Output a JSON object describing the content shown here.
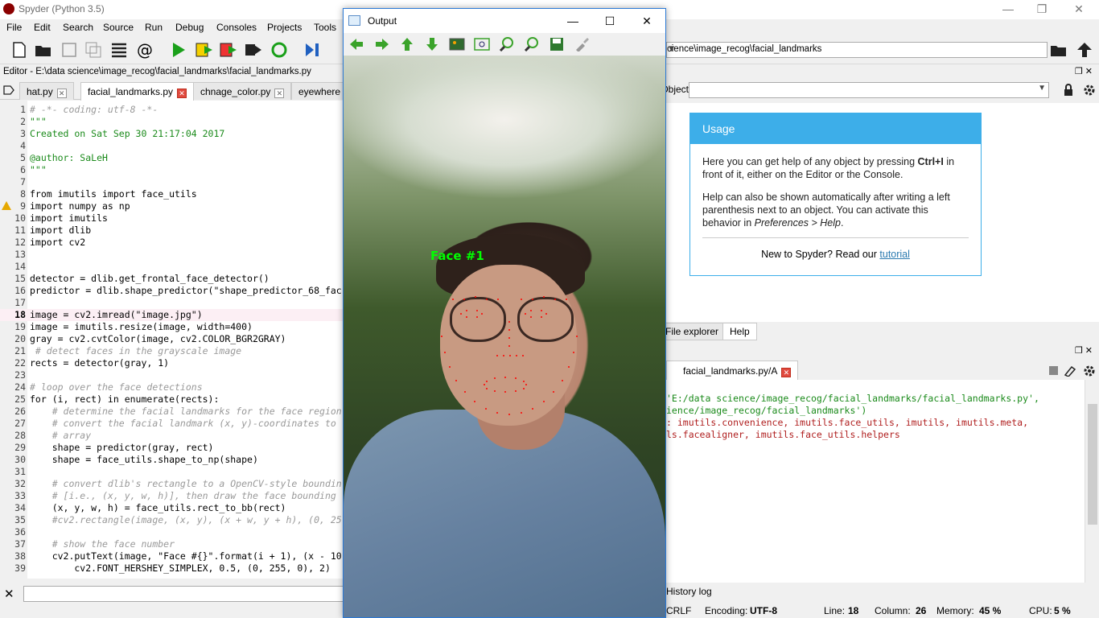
{
  "window": {
    "title": "Spyder (Python 3.5)",
    "controls": {
      "minimize": "—",
      "restore": "❐",
      "close": "✕"
    }
  },
  "menu": [
    "File",
    "Edit",
    "Search",
    "Source",
    "Run",
    "Debug",
    "Consoles",
    "Projects",
    "Tools"
  ],
  "editor": {
    "path": "Editor - E:\\data science\\image_recog\\facial_landmarks\\facial_landmarks.py",
    "tabs": [
      "hat.py",
      "facial_landmarks.py",
      "chnage_color.py",
      "eyewhere"
    ],
    "active_tab": "facial_landmarks.py",
    "lines": [
      {
        "n": "1",
        "t": "# -*- coding: utf-8 -*-",
        "c": "cmt"
      },
      {
        "n": "2",
        "t": "\"\"\"",
        "c": "str"
      },
      {
        "n": "3",
        "t": "Created on Sat Sep 30 21:17:04 2017",
        "c": "str"
      },
      {
        "n": "4",
        "t": "",
        "c": ""
      },
      {
        "n": "5",
        "t": "@author: SaLeH",
        "c": "str"
      },
      {
        "n": "6",
        "t": "\"\"\"",
        "c": "str"
      },
      {
        "n": "7",
        "t": "",
        "c": ""
      },
      {
        "n": "8",
        "t": "from imutils import face_utils",
        "c": ""
      },
      {
        "n": "9",
        "t": "import numpy as np",
        "c": ""
      },
      {
        "n": "10",
        "t": "import imutils",
        "c": ""
      },
      {
        "n": "11",
        "t": "import dlib",
        "c": ""
      },
      {
        "n": "12",
        "t": "import cv2",
        "c": ""
      },
      {
        "n": "13",
        "t": "",
        "c": ""
      },
      {
        "n": "14",
        "t": "",
        "c": ""
      },
      {
        "n": "15",
        "t": "detector = dlib.get_frontal_face_detector()",
        "c": ""
      },
      {
        "n": "16",
        "t": "predictor = dlib.shape_predictor(\"shape_predictor_68_fac",
        "c": ""
      },
      {
        "n": "17",
        "t": "",
        "c": ""
      },
      {
        "n": "18",
        "t": "image = cv2.imread(\"image.jpg\")",
        "c": ""
      },
      {
        "n": "19",
        "t": "image = imutils.resize(image, width=400)",
        "c": ""
      },
      {
        "n": "20",
        "t": "gray = cv2.cvtColor(image, cv2.COLOR_BGR2GRAY)",
        "c": ""
      },
      {
        "n": "21",
        "t": " # detect faces in the grayscale image",
        "c": "cmt"
      },
      {
        "n": "22",
        "t": "rects = detector(gray, 1)",
        "c": ""
      },
      {
        "n": "23",
        "t": "",
        "c": ""
      },
      {
        "n": "24",
        "t": "# loop over the face detections",
        "c": "cmt"
      },
      {
        "n": "25",
        "t": "for (i, rect) in enumerate(rects):",
        "c": ""
      },
      {
        "n": "26",
        "t": "    # determine the facial landmarks for the face region",
        "c": "cmt"
      },
      {
        "n": "27",
        "t": "    # convert the facial landmark (x, y)-coordinates to",
        "c": "cmt"
      },
      {
        "n": "28",
        "t": "    # array",
        "c": "cmt"
      },
      {
        "n": "29",
        "t": "    shape = predictor(gray, rect)",
        "c": ""
      },
      {
        "n": "30",
        "t": "    shape = face_utils.shape_to_np(shape)",
        "c": ""
      },
      {
        "n": "31",
        "t": "",
        "c": ""
      },
      {
        "n": "32",
        "t": "    # convert dlib's rectangle to a OpenCV-style boundin",
        "c": "cmt"
      },
      {
        "n": "33",
        "t": "    # [i.e., (x, y, w, h)], then draw the face bounding",
        "c": "cmt"
      },
      {
        "n": "34",
        "t": "    (x, y, w, h) = face_utils.rect_to_bb(rect)",
        "c": ""
      },
      {
        "n": "35",
        "t": "    #cv2.rectangle(image, (x, y), (x + w, y + h), (0, 25",
        "c": "cmt"
      },
      {
        "n": "36",
        "t": "",
        "c": ""
      },
      {
        "n": "37",
        "t": "    # show the face number",
        "c": "cmt"
      },
      {
        "n": "38",
        "t": "    cv2.putText(image, \"Face #{}\".format(i + 1), (x - 10",
        "c": ""
      },
      {
        "n": "39",
        "t": "        cv2.FONT_HERSHEY_SIMPLEX, 0.5, (0, 255, 0), 2)",
        "c": ""
      }
    ]
  },
  "output_window": {
    "title": "Output",
    "face_label": "Face #1"
  },
  "path_combo": "cience\\image_recog\\facial_landmarks",
  "help": {
    "object_label": "Object",
    "usage_title": "Usage",
    "p1_a": "Here you can get help of any object by pressing ",
    "p1_key": "Ctrl+I",
    "p1_b": " in front of it, either on the Editor or the Console.",
    "p2_a": "Help can also be shown automatically after writing a left parenthesis next to an object. You can activate this behavior in ",
    "p2_em": "Preferences > Help",
    "p2_b": ".",
    "new_text": "New to Spyder? Read our ",
    "tutorial": "tutorial",
    "tabs": [
      "File explorer",
      "Help"
    ]
  },
  "console": {
    "tab": "facial_landmarks.py/A",
    "lines": [
      "'E:/data science/image_recog/facial_landmarks/facial_landmarks.py',",
      "ience/image_recog/facial_landmarks')",
      ": imutils.convenience, imutils.face_utils, imutils, imutils.meta,",
      "ls.facealigner, imutils.face_utils.helpers"
    ],
    "history_tab": "History log"
  },
  "status": {
    "eol": "CRLF",
    "encoding_label": "Encoding:",
    "encoding": "UTF-8",
    "line_label": "Line:",
    "line": "18",
    "column_label": "Column:",
    "column": "26",
    "memory_label": "Memory:",
    "memory": "45 %",
    "cpu_label": "CPU:",
    "cpu": "5 %"
  }
}
